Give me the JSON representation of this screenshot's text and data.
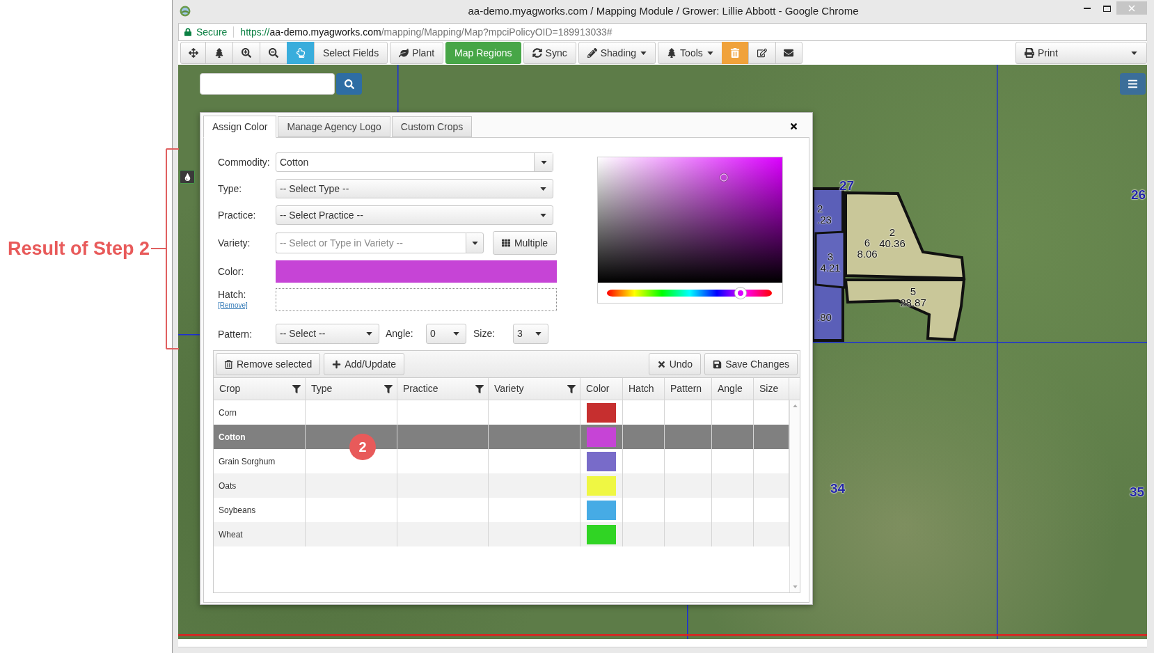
{
  "annotation": {
    "label": "Result of Step 2",
    "marker": "2"
  },
  "browser": {
    "title": "aa-demo.myagworks.com / Mapping Module / Grower: Lillie Abbott - Google Chrome",
    "secure": "Secure",
    "url": {
      "scheme": "https://",
      "host": "aa-demo.myagworks.com",
      "path": "/mapping/Mapping/Map?mpciPolicyOID=189913033#"
    }
  },
  "toolbar": {
    "groups": [
      [
        {
          "kind": "icon"
        },
        {
          "kind": "icon"
        },
        {
          "kind": "icon"
        },
        {
          "kind": "icon"
        },
        {
          "kind": "icon",
          "color": "#39addc"
        },
        {
          "kind": "text",
          "label": "Select Fields"
        }
      ],
      [
        {
          "kind": "text",
          "label": "Plant"
        }
      ],
      [
        {
          "kind": "text",
          "label": "Map Regions",
          "color": "#47a647"
        }
      ],
      [
        {
          "kind": "text",
          "label": "Sync"
        }
      ],
      [
        {
          "kind": "menu",
          "label": "Shading"
        }
      ],
      [
        {
          "kind": "menu",
          "label": "Tools"
        },
        {
          "kind": "icon",
          "color": "#f0a23b"
        },
        {
          "kind": "icon"
        },
        {
          "kind": "icon"
        }
      ]
    ],
    "print": {
      "label": "Print"
    }
  },
  "map": {
    "sections": [
      {
        "label": "27"
      },
      {
        "label": "26"
      },
      {
        "label": "34"
      },
      {
        "label": "35"
      }
    ],
    "fields": [
      {
        "lines": [
          "2",
          ".23"
        ]
      },
      {
        "lines": [
          "3",
          "4.21"
        ]
      },
      {
        "lines": [
          ".80"
        ]
      },
      {
        "lines": [
          "6",
          "8.06"
        ]
      },
      {
        "lines": [
          "2",
          "40.36"
        ]
      },
      {
        "lines": [
          "5",
          "28.87"
        ]
      }
    ]
  },
  "dialog": {
    "tabs": [
      {
        "label": "Assign Color",
        "selected": true
      },
      {
        "label": "Manage Agency Logo",
        "selected": false
      },
      {
        "label": "Custom Crops",
        "selected": false
      }
    ],
    "form": {
      "commodity": {
        "label": "Commodity:",
        "value": "Cotton"
      },
      "type": {
        "label": "Type:",
        "value": "-- Select Type --"
      },
      "practice": {
        "label": "Practice:",
        "value": "-- Select Practice --"
      },
      "variety": {
        "label": "Variety:",
        "placeholder": "-- Select or Type in Variety --",
        "button": "Multiple"
      },
      "color": {
        "label": "Color:",
        "color": "#c644d6"
      },
      "hatch": {
        "label": "Hatch:",
        "link": "[Remove]"
      },
      "pattern": {
        "label": "Pattern:",
        "value": "-- Select --"
      },
      "angle": {
        "label": "Angle:",
        "value": "0"
      },
      "size": {
        "label": "Size:",
        "value": "3"
      }
    },
    "picker": {
      "hue": {
        "level": 0.81
      }
    },
    "grid": {
      "actions_left": [
        {
          "label": "Remove selected"
        },
        {
          "label": "Add/Update"
        }
      ],
      "actions_right": [
        {
          "label": "Undo"
        },
        {
          "label": "Save Changes"
        }
      ],
      "columns": [
        {
          "label": "Crop",
          "filter": true
        },
        {
          "label": "Type",
          "filter": true
        },
        {
          "label": "Practice",
          "filter": true
        },
        {
          "label": "Variety",
          "filter": true
        },
        {
          "label": "Color",
          "filter": false
        },
        {
          "label": "Hatch",
          "filter": false
        },
        {
          "label": "Pattern",
          "filter": false
        },
        {
          "label": "Angle",
          "filter": false
        },
        {
          "label": "Size",
          "filter": false
        }
      ],
      "rows": [
        {
          "crop": "Corn",
          "color": "#c62f2f",
          "selected": false
        },
        {
          "crop": "Cotton",
          "color": "#c644d6",
          "selected": true
        },
        {
          "crop": "Grain Sorghum",
          "color": "#786bc9",
          "selected": false
        },
        {
          "crop": "Oats",
          "color": "#eff743",
          "selected": false
        },
        {
          "crop": "Soybeans",
          "color": "#46abe5",
          "selected": false
        },
        {
          "crop": "Wheat",
          "color": "#30d424",
          "selected": false
        }
      ]
    }
  }
}
